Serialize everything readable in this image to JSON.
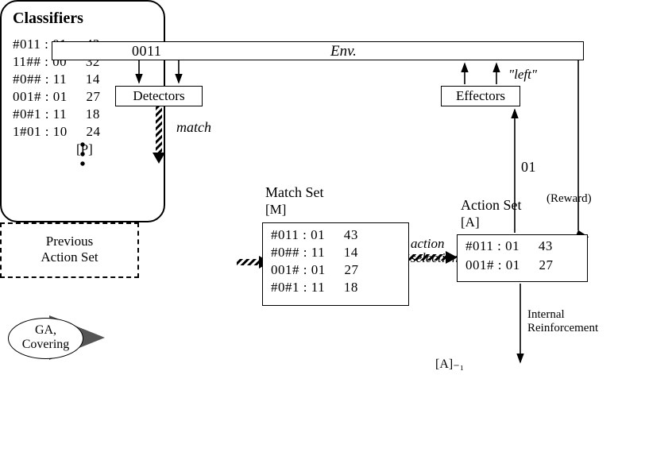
{
  "env": {
    "bits": "0011",
    "title": "Env."
  },
  "detectors": {
    "label": "Detectors"
  },
  "effectors": {
    "label": "Effectors",
    "output_annotation": "\"left\""
  },
  "labels": {
    "match": "match",
    "p": "[P]",
    "classifiers": "Classifiers",
    "match_set_title": "Match Set",
    "m": "[M]",
    "action_selection": "action\nselection",
    "action_set_title": "Action Set",
    "a": "[A]",
    "reward": "(Reward)",
    "action_code": "01",
    "a_minus1": "[A]₋₁",
    "previous_action_set": "Previous\nAction Set",
    "internal_reinforcement": "Internal\nReinforcement",
    "ga": "GA,\nCovering"
  },
  "classifiers": [
    {
      "cond": "#011",
      "act": "01",
      "str": 43
    },
    {
      "cond": "11##",
      "act": "00",
      "str": 32
    },
    {
      "cond": "#0##",
      "act": "11",
      "str": 14
    },
    {
      "cond": "001#",
      "act": "01",
      "str": 27
    },
    {
      "cond": "#0#1",
      "act": "11",
      "str": 18
    },
    {
      "cond": "1#01",
      "act": "10",
      "str": 24
    }
  ],
  "match_set": [
    {
      "cond": "#011",
      "act": "01",
      "str": 43
    },
    {
      "cond": "#0##",
      "act": "11",
      "str": 14
    },
    {
      "cond": "001#",
      "act": "01",
      "str": 27
    },
    {
      "cond": "#0#1",
      "act": "11",
      "str": 18
    }
  ],
  "action_set": [
    {
      "cond": "#011",
      "act": "01",
      "str": 43
    },
    {
      "cond": "001#",
      "act": "01",
      "str": 27
    }
  ]
}
